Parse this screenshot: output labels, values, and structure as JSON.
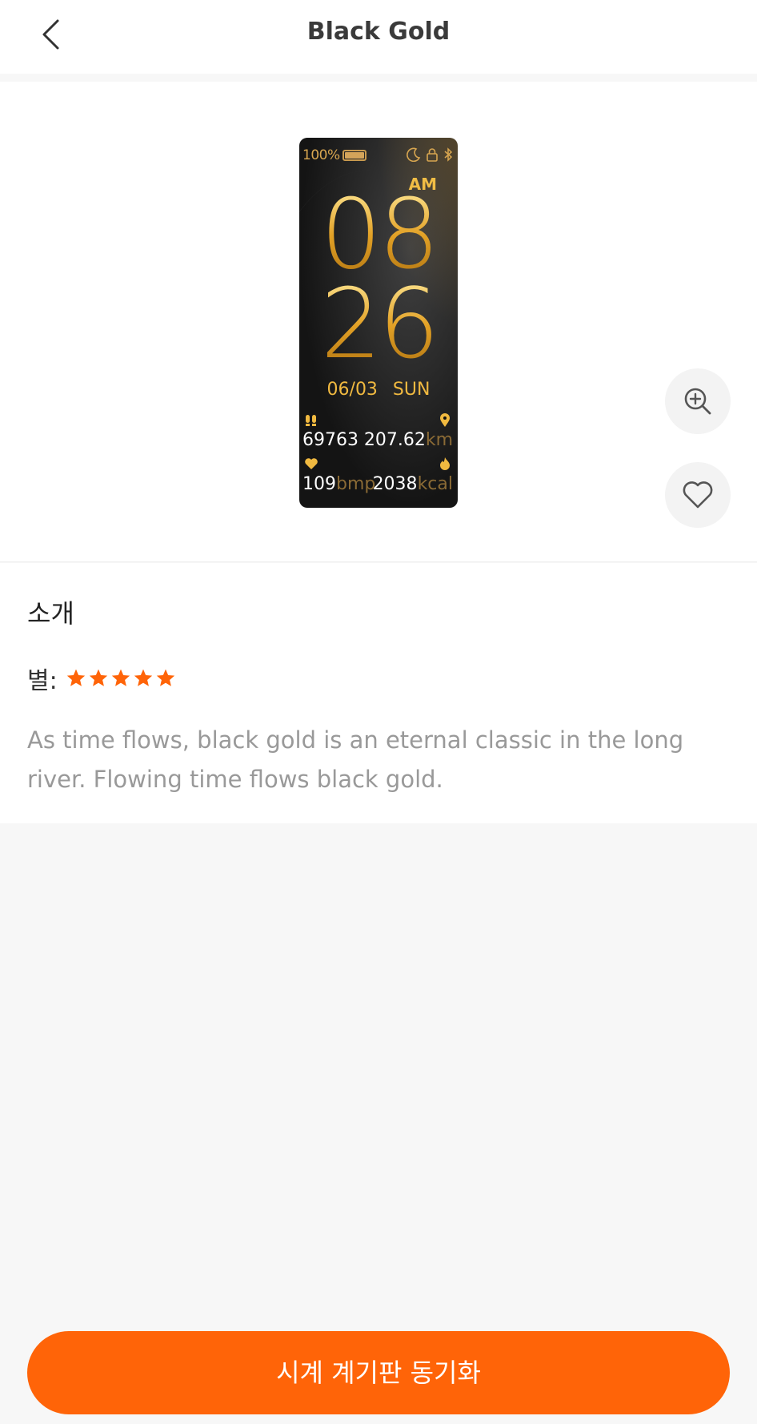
{
  "header": {
    "title": "Black Gold"
  },
  "watch_face": {
    "battery": "100%",
    "battery_level": 1.0,
    "ampm": "AM",
    "hours": "08",
    "minutes": "26",
    "date": "06/03 SUN",
    "steps": "69763",
    "distance": "207.62",
    "distance_unit": "km",
    "heart_rate": "109",
    "heart_rate_unit": "bmp",
    "calories": "2038",
    "calories_unit": "kcal"
  },
  "info": {
    "section_title": "소개",
    "rating_label": "별:",
    "rating": 5,
    "rating_max": 5,
    "description": "As time flows, black gold is an eternal classic in the long river. Flowing time flows black gold."
  },
  "actions": {
    "sync_label": "시계 계기판 동기화"
  },
  "colors": {
    "accent": "#ff6408",
    "gold": "#f0b940",
    "description_text": "#999999"
  },
  "icons": {
    "back": "chevron-left-icon",
    "zoom": "zoom-in-icon",
    "favorite": "heart-outline-icon",
    "star": "star-icon"
  }
}
